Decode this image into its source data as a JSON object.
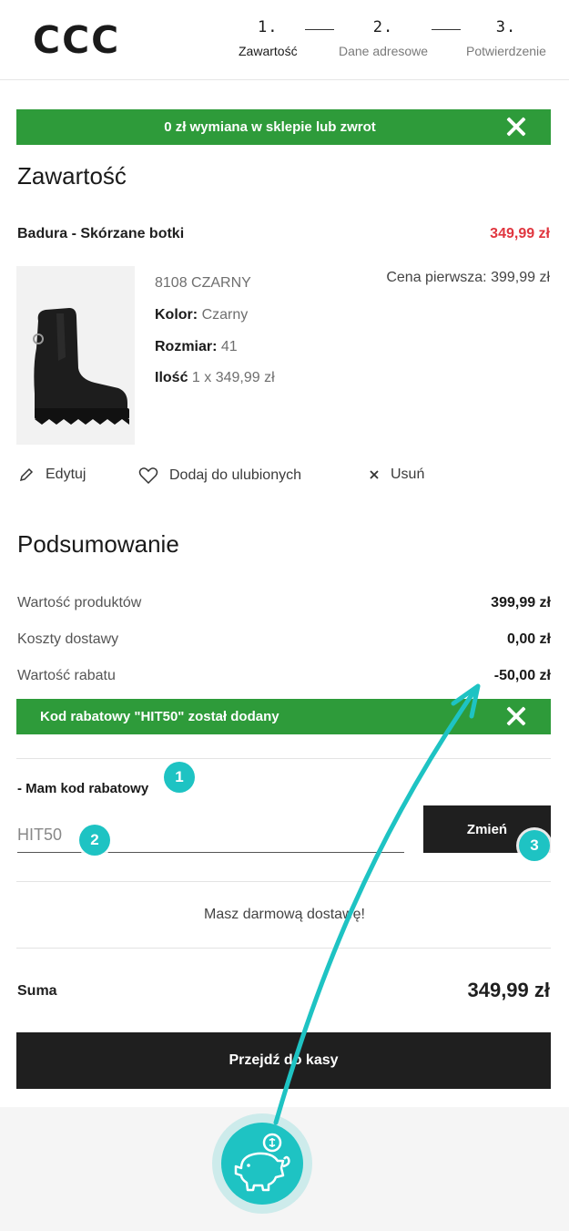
{
  "header": {
    "logo": "CCC",
    "steps": [
      {
        "num": "1.",
        "label": "Zawartość"
      },
      {
        "num": "2.",
        "label": "Dane adresowe"
      },
      {
        "num": "3.",
        "label": "Potwierdzenie"
      }
    ]
  },
  "banner_exchange": {
    "text": "0 zł wymiana w sklepie lub zwrot"
  },
  "cart": {
    "title": "Zawartość",
    "product": {
      "name": "Badura - Skórzane botki",
      "price": "349,99 zł",
      "sku": "8108 CZARNY",
      "color_label": "Kolor:",
      "color_value": "Czarny",
      "size_label": "Rozmiar:",
      "size_value": "41",
      "qty_label": "Ilość",
      "qty_value": "1 x 349,99 zł",
      "first_price": "Cena pierwsza: 399,99 zł"
    },
    "actions": {
      "edit": "Edytuj",
      "favorite": "Dodaj do ulubionych",
      "remove": "Usuń"
    }
  },
  "summary": {
    "title": "Podsumowanie",
    "rows": [
      {
        "label": "Wartość produktów",
        "value": "399,99 zł"
      },
      {
        "label": "Koszty dostawy",
        "value": "0,00 zł"
      },
      {
        "label": "Wartość rabatu",
        "value": "-50,00 zł"
      }
    ],
    "coupon_banner": "Kod rabatowy \"HIT50\" został dodany",
    "coupon_label": "- Mam kod rabatowy",
    "coupon_value": "HIT50",
    "change_button": "Zmień",
    "free_shipping": "Masz darmową dostawę!",
    "total_label": "Suma",
    "total_value": "349,99 zł",
    "checkout_button": "Przejdź do kasy"
  },
  "annotations": {
    "badge1": "1",
    "badge2": "2",
    "badge3": "3"
  },
  "colors": {
    "accent_green": "#2e9b3a",
    "price_red": "#e0363f",
    "annotation_teal": "#1ec3c3",
    "button_dark": "#1f1f1f"
  },
  "icons": {
    "piggy": "piggy-bank-icon",
    "edit": "pencil-icon",
    "favorite": "heart-icon",
    "remove": "close-icon"
  }
}
